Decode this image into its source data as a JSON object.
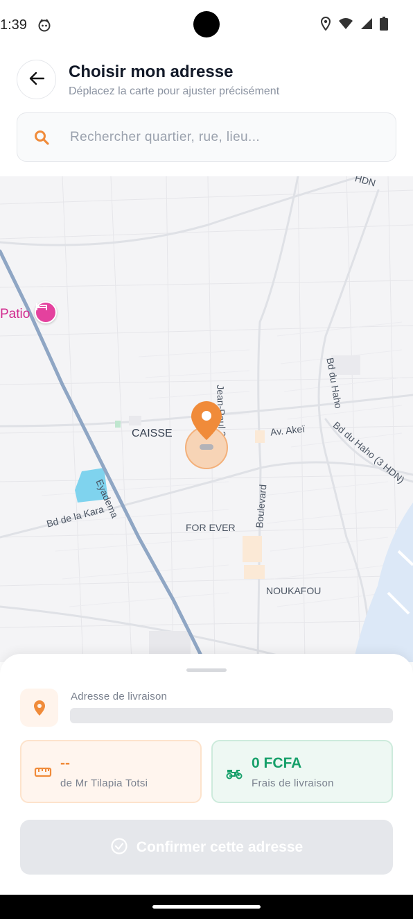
{
  "status_bar": {
    "time": "1:39"
  },
  "header": {
    "title": "Choisir mon adresse",
    "subtitle": "Déplacez la carte pour ajuster précisément"
  },
  "search": {
    "placeholder": "Rechercher quartier, rue, lieu...",
    "value": ""
  },
  "map": {
    "poi_name": "Patio",
    "labels": {
      "hdn_top": "HDN",
      "jean_paul": "Jean-Paul 2",
      "bd_haho": "Bd du Haho",
      "bd_haho_3hdn": "Bd du Haho (3 HDN)",
      "av_akei": "Av. Akeï",
      "caisse": "CAISSE",
      "eyadema": "Eyadema",
      "bd_kara": "Bd de la Kara",
      "for_ever": "FOR EVER",
      "boulevard": "Boulevard",
      "noukafou": "NOUKAFOU"
    }
  },
  "sheet": {
    "address_label": "Adresse de livraison",
    "distance": {
      "value": "--",
      "caption": "de Mr Tilapia Totsi"
    },
    "fee": {
      "value": "0 FCFA",
      "caption": "Frais de livraison"
    },
    "confirm_label": "Confirmer cette adresse"
  },
  "colors": {
    "accent": "#f08b3a",
    "success": "#16a06a",
    "poi": "#e4419e",
    "road_major": "#8fa6c4",
    "water": "#7fd3ee"
  },
  "icons": {
    "back": "arrow-left-icon",
    "search": "search-icon",
    "pin": "location-pin-icon",
    "ruler": "ruler-icon",
    "scooter": "scooter-icon",
    "check": "check-circle-icon",
    "hotel": "hotel-icon"
  }
}
